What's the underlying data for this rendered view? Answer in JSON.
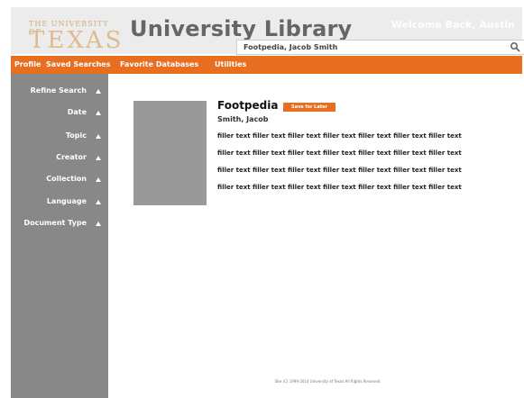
{
  "branding": {
    "logo_top": "THE UNIVERSITY OF",
    "logo_main": "TEXAS",
    "app_title": "University Library",
    "welcome": "Welcome Back, Austin"
  },
  "search": {
    "value": "Footpedia, Jacob Smith"
  },
  "nav": {
    "items": [
      {
        "label": "Profile"
      },
      {
        "label": "Saved Searches"
      },
      {
        "label": "Favorite Databases"
      },
      {
        "label": "Utilities"
      }
    ]
  },
  "sidebar": {
    "items": [
      {
        "label": "Refine Search"
      },
      {
        "label": "Date"
      },
      {
        "label": "Topic"
      },
      {
        "label": "Creator"
      },
      {
        "label": "Collection"
      },
      {
        "label": "Language"
      },
      {
        "label": "Document Type"
      }
    ]
  },
  "record": {
    "title": "Footpedia",
    "save_label": "Save for Later",
    "author": "Smith, Jacob",
    "description_lines": [
      "filler text filler text filler text filler text filler text filler text filler text",
      "filler text filler text filler text filler text filler text filler text filler text",
      "filler text filler text filler text filler text filler text filler text filler text",
      "filler text filler text filler text filler text filler text filler text filler text"
    ]
  },
  "footer": {
    "text": "Site (C) 1999-2014 University of Texas All Rights Reserved"
  },
  "icons": {
    "search": "search-icon",
    "collapse": "chevron-up-icon"
  },
  "colors": {
    "accent": "#e86f22",
    "header_bg": "#ececec",
    "sidebar_bg": "#888888",
    "thumbnail": "#999999",
    "logo": "#dfbb8f"
  }
}
